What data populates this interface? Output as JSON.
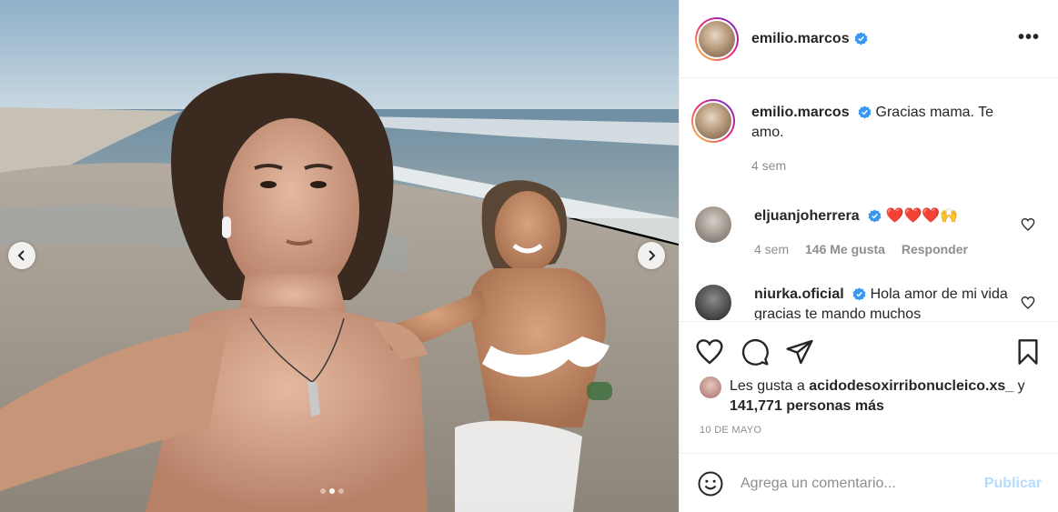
{
  "post": {
    "author": "emilio.marcos",
    "more_label": "•••",
    "carousel": {
      "slide_count": 3,
      "active_index": 1
    }
  },
  "caption": {
    "username": "emilio.marcos",
    "text": "Gracias mama. Te amo.",
    "time": "4 sem"
  },
  "comments": [
    {
      "username": "eljuanjoherrera",
      "text": "❤️❤️❤️🙌",
      "time": "4 sem",
      "likes": "146 Me gusta",
      "reply_label": "Responder"
    },
    {
      "username": "niurka.oficial",
      "text": "Hola amor de mi vida gracias te mando muchos"
    }
  ],
  "liked_by": {
    "prefix": "Les gusta a",
    "user": "acidodesoxirribonucleico.xs_",
    "joiner": "y",
    "others": "141,771 personas más"
  },
  "date": "10 DE MAYO",
  "comment_box": {
    "placeholder": "Agrega un comentario...",
    "publish_label": "Publicar"
  },
  "icons": {
    "verified": "verified-badge-icon",
    "like": "heart-icon",
    "comment": "comment-bubble-icon",
    "share": "paper-plane-icon",
    "save": "bookmark-icon",
    "emoji": "smiley-icon",
    "prev": "chevron-left-icon",
    "next": "chevron-right-icon"
  },
  "colors": {
    "verified_blue": "#3897f0",
    "publish_disabled": "#b3dbff",
    "muted_text": "#8e8e8e"
  }
}
